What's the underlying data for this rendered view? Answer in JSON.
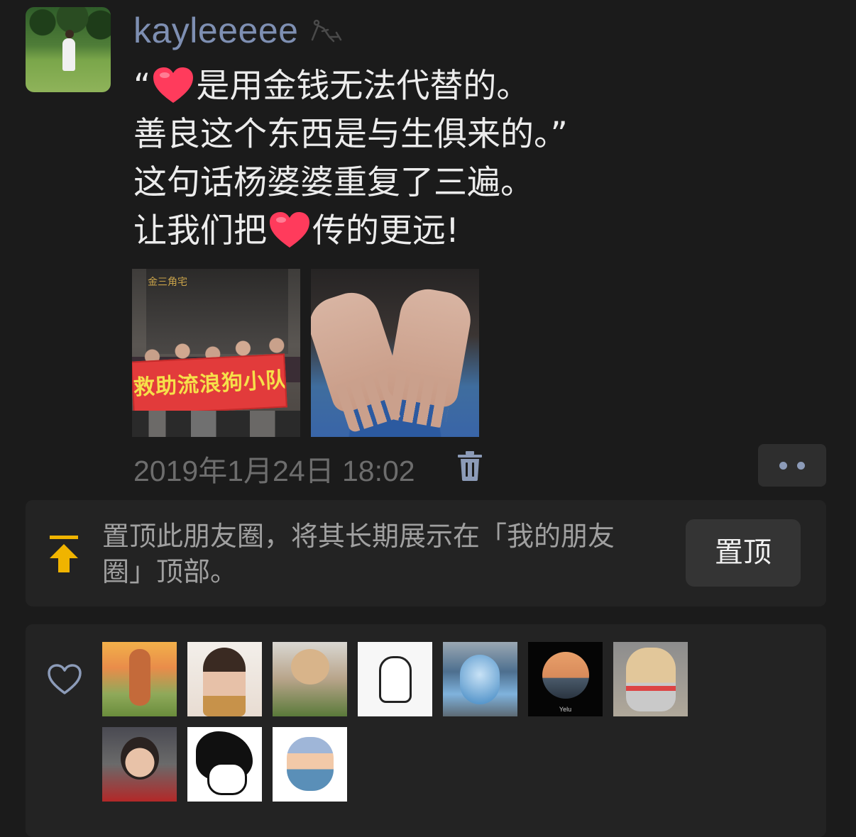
{
  "post": {
    "username": "kayleeeee",
    "status_icon": "game-controller-icon",
    "text_lines": [
      {
        "before": "“",
        "emoji": "heart",
        "after": "是用金钱无法代替的。"
      },
      {
        "before": "善良这个东西是与生俱来的。”",
        "emoji": null,
        "after": ""
      },
      {
        "before": "这句话杨婆婆重复了三遍。",
        "emoji": null,
        "after": ""
      },
      {
        "before": "让我们把",
        "emoji": "heart",
        "after": "传的更远!"
      }
    ],
    "photos": [
      {
        "name": "photo-dog-rescue-team",
        "banner_text": "救助流浪狗小队",
        "sign_text": "金三角宅"
      },
      {
        "name": "photo-elderly-hands"
      }
    ],
    "timestamp": "2019年1月24日 18:02"
  },
  "pin": {
    "text": "置顶此朋友圈，将其长期展示在「我的朋友圈」顶部。",
    "button_label": "置顶",
    "icon": "pin-to-top-icon",
    "icon_color": "#f0b400"
  },
  "likes": {
    "icon": "heart-outline-icon",
    "likers": [
      {
        "name": "liker-avatar-1"
      },
      {
        "name": "liker-avatar-2"
      },
      {
        "name": "liker-avatar-3"
      },
      {
        "name": "liker-avatar-4"
      },
      {
        "name": "liker-avatar-5"
      },
      {
        "name": "liker-avatar-6",
        "label": "Yelu"
      },
      {
        "name": "liker-avatar-7"
      },
      {
        "name": "liker-avatar-8"
      },
      {
        "name": "liker-avatar-9"
      },
      {
        "name": "liker-avatar-10"
      }
    ]
  },
  "colors": {
    "background": "#1b1b1b",
    "username": "#7e8fb2",
    "text": "#ececec",
    "timestamp": "#6d6d6d",
    "card": "#232323",
    "heart_emoji": "#ff3b5c",
    "pin_icon": "#f0b400"
  }
}
